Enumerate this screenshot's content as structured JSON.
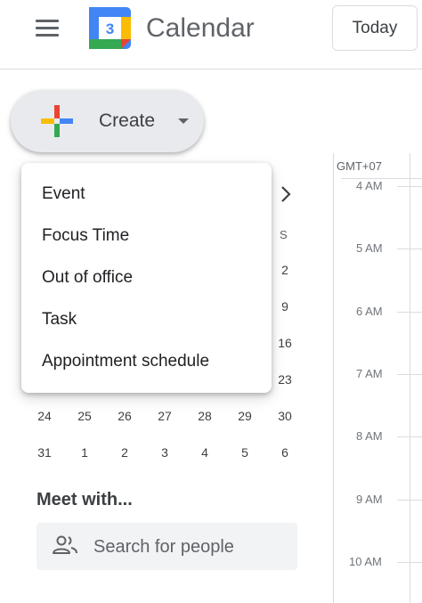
{
  "header": {
    "app_title": "Calendar",
    "logo_day": "3",
    "today_label": "Today"
  },
  "create": {
    "label": "Create"
  },
  "create_menu": {
    "items": [
      "Event",
      "Focus Time",
      "Out of office",
      "Task",
      "Appointment schedule"
    ]
  },
  "mini_calendar": {
    "visible_day_letter": "S",
    "visible_last_column_dates": [
      "2",
      "9",
      "16",
      "23"
    ],
    "week_rows": [
      [
        "24",
        "25",
        "26",
        "27",
        "28",
        "29",
        "30"
      ],
      [
        "31",
        "1",
        "2",
        "3",
        "4",
        "5",
        "6"
      ]
    ]
  },
  "meet": {
    "title": "Meet with...",
    "search_placeholder": "Search for people"
  },
  "time_grid": {
    "timezone": "GMT+07",
    "hours": [
      "4 AM",
      "5 AM",
      "6 AM",
      "7 AM",
      "8 AM",
      "9 AM",
      "10 AM"
    ]
  },
  "colors": {
    "logo_blue": "#4285f4",
    "logo_green": "#34a853",
    "logo_yellow": "#fbbc04",
    "logo_red": "#ea4335"
  }
}
